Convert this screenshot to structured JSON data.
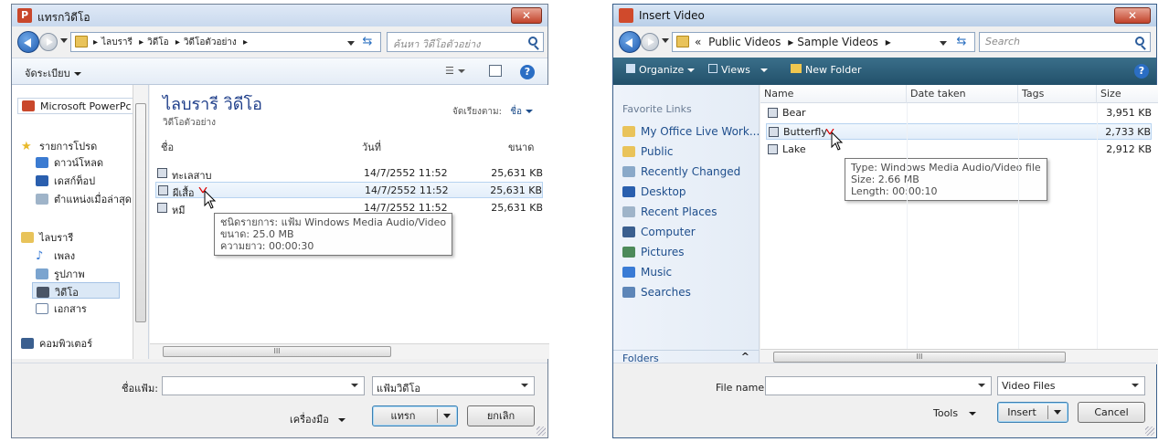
{
  "thai_dialog": {
    "title": "แทรกวิดีโอ",
    "breadcrumb": [
      "ไลบรารี",
      "วิดีโอ",
      "วิดีโอตัวอย่าง"
    ],
    "search_placeholder": "ค้นหา วิดีโอตัวอย่าง",
    "toolbar": {
      "organize": "จัดระเบียบ"
    },
    "nav": {
      "items": [
        "Microsoft PowerPc",
        "รายการโปรด",
        "ดาวน์โหลด",
        "เดสก์ท็อป",
        "ตำแหน่งเมื่อล่าสุด",
        "ไลบรารี",
        "เพลง",
        "รูปภาพ",
        "วิดีโอ",
        "เอกสาร",
        "คอมพิวเตอร์"
      ]
    },
    "library_title": "ไลบรารี วิดีโอ",
    "library_sub": "วิดีโอตัวอย่าง",
    "arrange_by_label": "จัดเรียงตาม:",
    "arrange_by_value": "ชื่อ",
    "columns": {
      "name": "ชื่อ",
      "date": "วันที่",
      "size": "ขนาด"
    },
    "files": [
      {
        "name": "ทะเลสาบ",
        "date": "14/7/2552 11:52",
        "size": "25,631 KB"
      },
      {
        "name": "ผีเสื้อ",
        "date": "14/7/2552 11:52",
        "size": "25,631 KB"
      },
      {
        "name": "หมี",
        "date": "14/7/2552 11:52",
        "size": "25,631 KB"
      }
    ],
    "tooltip": {
      "type": "ชนิดรายการ: แฟ้ม Windows Media Audio/Video",
      "size": "ขนาด: 25.0 MB",
      "length": "ความยาว: 00:00:30"
    },
    "scroll_mark": "III",
    "filename_label": "ชื่อแฟ้ม:",
    "filename_value": "",
    "filetype_value": "แฟ้มวิดีโอ",
    "tools_label": "เครื่องมือ",
    "insert_label": "แทรก",
    "cancel_label": "ยกเลิก"
  },
  "english_dialog": {
    "title": "Insert Video",
    "breadcrumb_prefix": "«",
    "breadcrumb": [
      "Public Videos",
      "Sample Videos"
    ],
    "search_placeholder": "Search",
    "toolbar": {
      "organize": "Organize",
      "views": "Views",
      "new_folder": "New Folder"
    },
    "favorite_links": "Favorite Links",
    "nav": {
      "items": [
        "My Office Live Work...",
        "Public",
        "Recently Changed",
        "Desktop",
        "Recent Places",
        "Computer",
        "Pictures",
        "Music",
        "Searches"
      ]
    },
    "folders_label": "Folders",
    "columns": {
      "name": "Name",
      "date": "Date taken",
      "tags": "Tags",
      "size": "Size"
    },
    "files": [
      {
        "name": "Bear",
        "size": "3,951 KB"
      },
      {
        "name": "Butterfly",
        "size": "2,733 KB"
      },
      {
        "name": "Lake",
        "size": "2,912 KB"
      }
    ],
    "tooltip": {
      "type": "Type: Windows Media Audio/Video file",
      "size": "Size: 2.66 MB",
      "length": "Length: 00:00:10"
    },
    "scroll_mark": "III",
    "filename_label": "File name:",
    "filename_value": "",
    "filetype_value": "Video Files",
    "tools_label": "Tools",
    "insert_label": "Insert",
    "cancel_label": "Cancel"
  }
}
